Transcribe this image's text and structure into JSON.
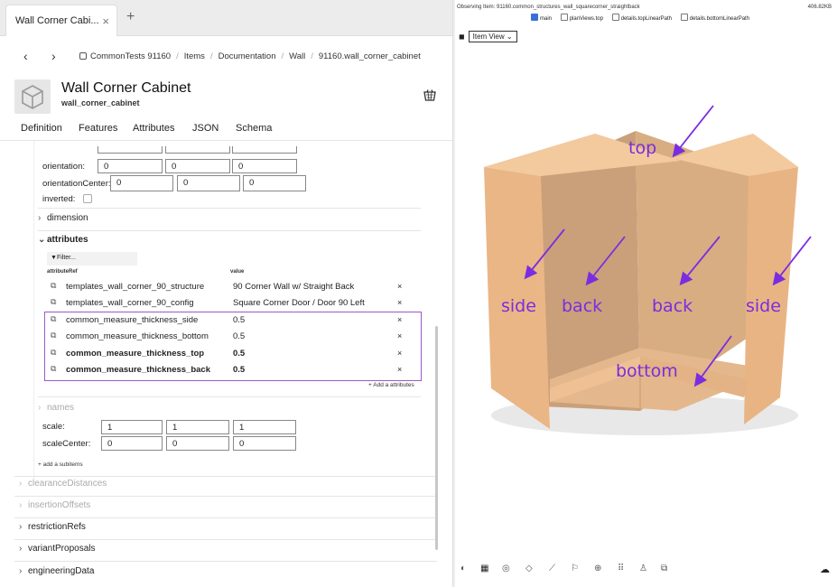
{
  "tab": {
    "title": "Wall Corner Cabi...",
    "close": "×",
    "new": "+"
  },
  "nav": {
    "back": "‹",
    "forward": "›"
  },
  "breadcrumb": [
    "CommonTests 91160",
    "Items",
    "Documentation",
    "Wall",
    "91160.wall_corner_cabinet"
  ],
  "header": {
    "title": "Wall Corner Cabinet",
    "subtitle": "wall_corner_cabinet"
  },
  "tabs": [
    "Definition",
    "Features",
    "Attributes",
    "JSON",
    "Schema"
  ],
  "properties": {
    "orientation_label": "orientation:",
    "orientation": [
      "0",
      "0",
      "0"
    ],
    "orientationCenter_label": "orientationCenter:",
    "orientationCenter": [
      "0",
      "0",
      "0"
    ],
    "inverted_label": "inverted:"
  },
  "sections": {
    "dimension": "dimension",
    "attributes": "attributes",
    "names": "names",
    "clearanceDistances": "clearanceDistances",
    "insertionOffsets": "insertionOffsets",
    "restrictionRefs": "restrictionRefs",
    "variantProposals": "variantProposals",
    "engineeringData": "engineeringData"
  },
  "attributes": {
    "filter_placeholder": "Filter...",
    "col_ref": "attributeRef",
    "col_value": "value",
    "rows": [
      {
        "ref": "templates_wall_corner_90_structure",
        "value": "90 Corner Wall w/ Straight Back",
        "bold": false
      },
      {
        "ref": "templates_wall_corner_90_config",
        "value": "Square Corner Door / Door 90 Left",
        "bold": false
      },
      {
        "ref": "common_measure_thickness_side",
        "value": "0.5",
        "bold": false
      },
      {
        "ref": "common_measure_thickness_bottom",
        "value": "0.5",
        "bold": false
      },
      {
        "ref": "common_measure_thickness_top",
        "value": "0.5",
        "bold": true
      },
      {
        "ref": "common_measure_thickness_back",
        "value": "0.5",
        "bold": true
      }
    ],
    "remove": "×",
    "add_label": "+ Add a attributes"
  },
  "scale": {
    "label": "scale:",
    "values": [
      "1",
      "1",
      "1"
    ]
  },
  "scaleCenter": {
    "label": "scaleCenter:",
    "values": [
      "0",
      "0",
      "0"
    ]
  },
  "add_subitem": "+ add a subitems",
  "viewer": {
    "observing": "Observing Item: 91160.common_structures_wall_squarecorner_straightback",
    "size": "406.82KB",
    "layers": [
      {
        "label": "main",
        "checked": true
      },
      {
        "label": "planViews.top",
        "checked": false
      },
      {
        "label": "details.topLinearPath",
        "checked": false
      },
      {
        "label": "details.bottomLinearPath",
        "checked": false
      }
    ],
    "view_select": "Item View",
    "annotations": {
      "top": "top",
      "side_left": "side",
      "back_left": "back",
      "back_right": "back",
      "side_right": "side",
      "bottom": "bottom"
    },
    "colors": {
      "annotation": "#7a2de0",
      "wood": "#e8b487"
    }
  }
}
